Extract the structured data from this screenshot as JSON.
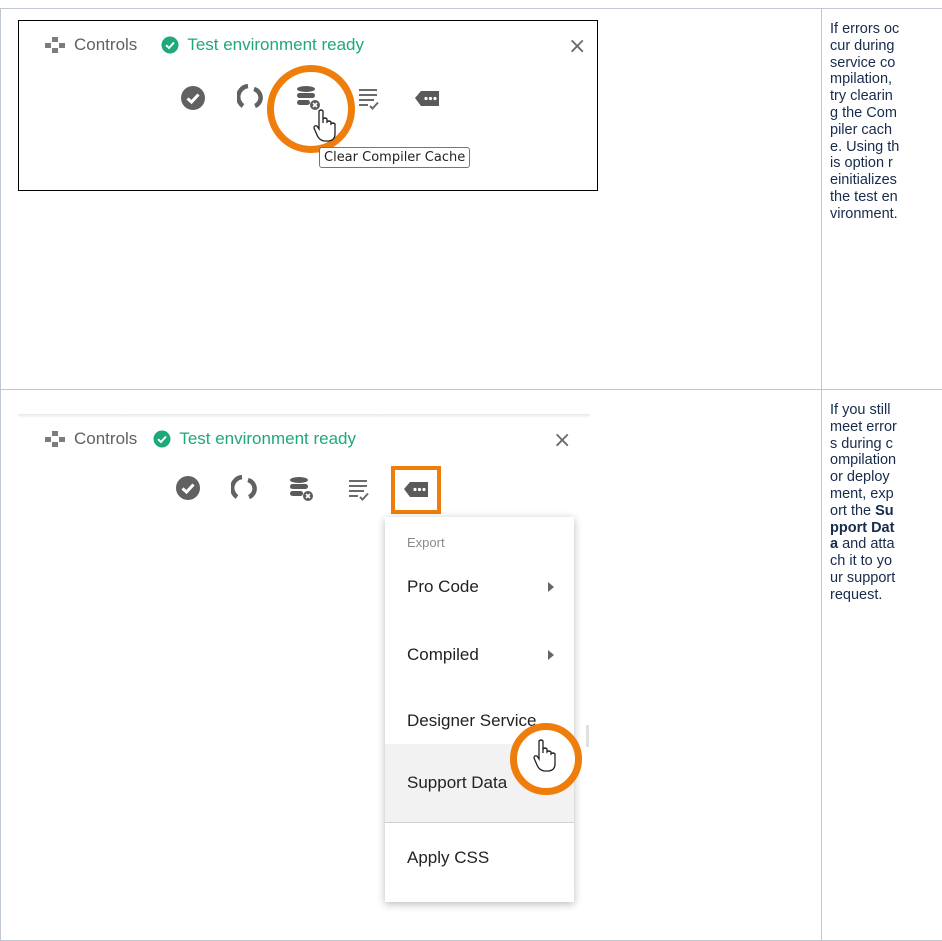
{
  "rows": [
    {
      "screenshot": {
        "controls_label": "Controls",
        "status_text": "Test environment ready",
        "close_symbol": "×",
        "tooltip": "Clear Compiler Cache",
        "toolbar": [
          "validate-icon",
          "refresh-icon",
          "clear-cache-icon",
          "logs-icon",
          "more-icon"
        ]
      },
      "description": "If errors occur during service compilation, try clearing the Compiler cache. Using this option reinitializes the test environment."
    },
    {
      "screenshot": {
        "controls_label": "Controls",
        "status_text": "Test environment ready",
        "close_symbol": "×",
        "menu": {
          "header": "Export",
          "items": [
            {
              "label": "Pro Code",
              "submenu": true
            },
            {
              "label": "Compiled",
              "submenu": true
            },
            {
              "label": "Designer Service",
              "submenu": false
            },
            {
              "label": "Support Data",
              "submenu": false
            },
            {
              "label": "Apply CSS",
              "submenu": false
            }
          ]
        }
      },
      "description_before": "If you still meet errors during compilation or deployment, export the ",
      "description_bold": "Support Data",
      "description_after": " and attach it to your support request."
    }
  ],
  "colors": {
    "accent": "#ee7d0c",
    "status": "#1fa87a",
    "text": "#172b4d"
  }
}
